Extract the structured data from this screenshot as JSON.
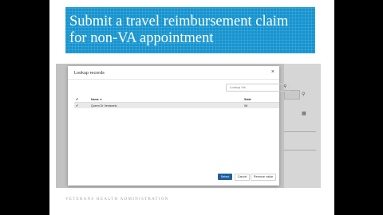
{
  "slide": {
    "title": "Submit a travel reimbursement claim\nfor non-VA appointment",
    "footer": "VETERANS HEALTH ADMINISTRATION"
  },
  "modal": {
    "title": "Lookup records",
    "close_icon": "close-icon",
    "search": {
      "value": "Lookup Vis",
      "icon": "search-icon"
    },
    "columns": {
      "name": "Name",
      "state": "State",
      "sort_indicator": "▼"
    },
    "rows": [
      {
        "name": "Queen Dr Ventanels",
        "state": "WI",
        "checked": true
      }
    ],
    "buttons": {
      "select": "Select",
      "cancel": "Cancel",
      "remove": "Remove value"
    }
  },
  "colors": {
    "title_band": "#1694cf",
    "primary_button": "#1f5e9e"
  }
}
